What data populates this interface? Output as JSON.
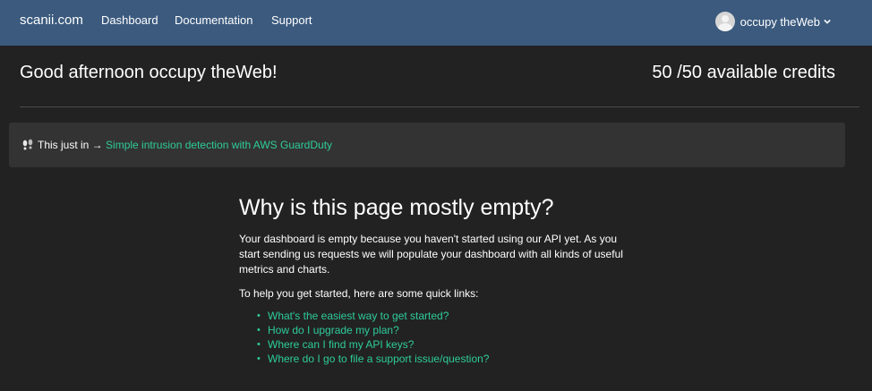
{
  "nav": {
    "brand": "scanii.com",
    "links": [
      "Dashboard",
      "Documentation",
      "Support"
    ],
    "user_name": "occupy theWeb"
  },
  "header": {
    "greeting": "Good afternoon occupy theWeb!",
    "credits": "50 /50 available credits"
  },
  "news": {
    "prefix": "This just in →",
    "link": "Simple intrusion detection with AWS GuardDuty"
  },
  "empty_state": {
    "title": "Why is this page mostly empty?",
    "description": "Your dashboard is empty because you haven't started using our API yet. As you start sending us requests we will populate your dashboard with all kinds of useful metrics and charts.",
    "quick_links_intro": "To help you get started, here are some quick links:",
    "quick_links": [
      "What's the easiest way to get started?",
      "How do I upgrade my plan?",
      "Where can I find my API keys?",
      "Where do I go to file a support issue/question?"
    ]
  },
  "colors": {
    "nav_bg": "#3b5a7e",
    "page_bg": "#222222",
    "accent_link": "#2ecc9a"
  },
  "icons": [
    "user-avatar-icon",
    "chevron-down-icon",
    "footprints-icon"
  ]
}
